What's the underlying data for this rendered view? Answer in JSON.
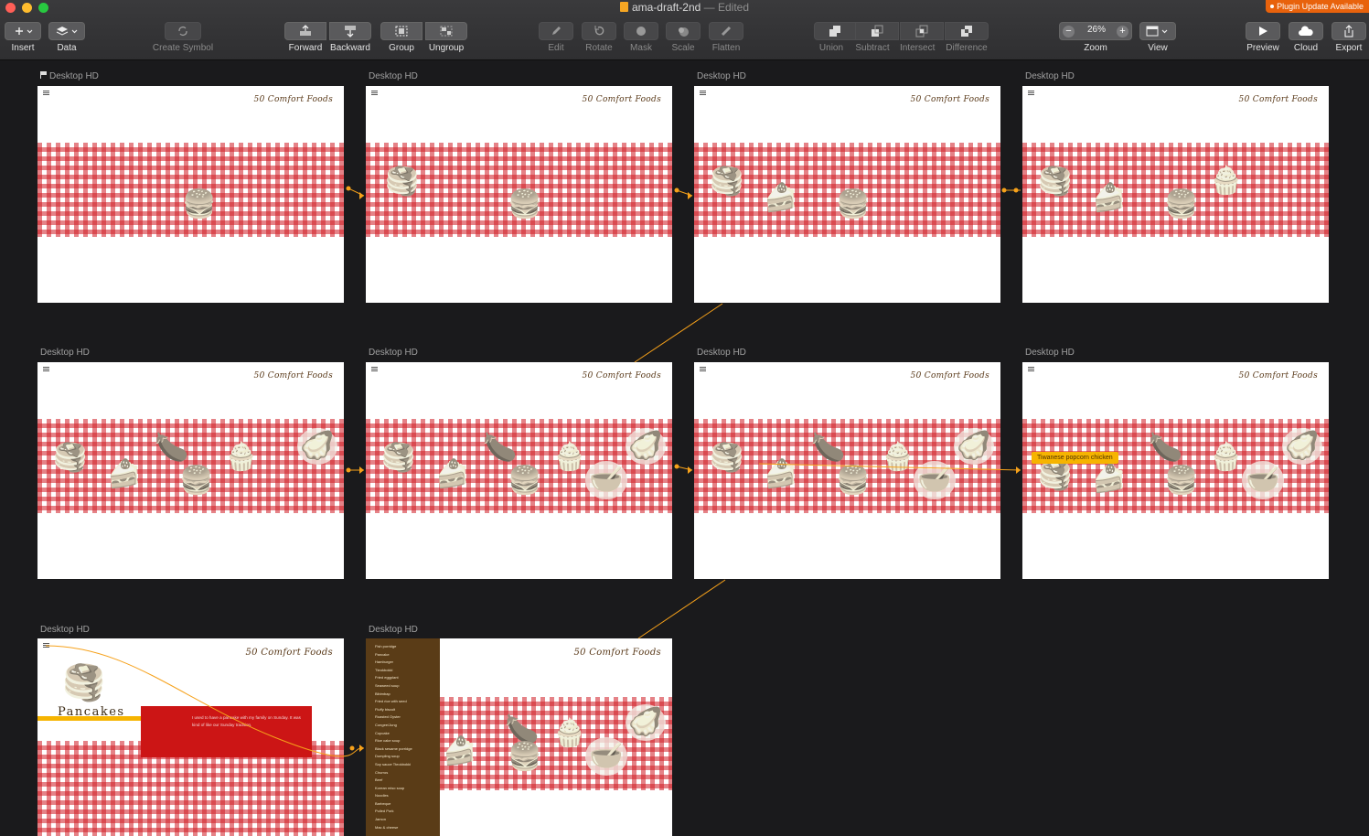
{
  "window": {
    "file_name": "ama-draft-2nd",
    "edited_suffix": "— Edited",
    "plugin_badge": "Plugin Update Available",
    "colors": {
      "close": "#ff5f57",
      "minimize": "#febc2e",
      "maximize": "#28c840",
      "badge": "#e8620c"
    }
  },
  "toolbar": {
    "insert": "Insert",
    "data": "Data",
    "create_symbol": "Create Symbol",
    "forward": "Forward",
    "backward": "Backward",
    "group": "Group",
    "ungroup": "Ungroup",
    "edit": "Edit",
    "rotate": "Rotate",
    "mask": "Mask",
    "scale": "Scale",
    "flatten": "Flatten",
    "union": "Union",
    "subtract": "Subtract",
    "intersect": "Intersect",
    "difference": "Difference",
    "zoom_value": "26%",
    "zoom": "Zoom",
    "view": "View",
    "preview": "Preview",
    "cloud": "Cloud",
    "export": "Export"
  },
  "artboards": [
    {
      "label": "Desktop HD",
      "title": "50 Comfort Foods"
    },
    {
      "label": "Desktop HD",
      "title": "50 Comfort Foods"
    },
    {
      "label": "Desktop HD",
      "title": "50 Comfort Foods"
    },
    {
      "label": "Desktop HD",
      "title": "50 Comfort Foods"
    },
    {
      "label": "Desktop HD",
      "title": "50 Comfort Foods"
    },
    {
      "label": "Desktop HD",
      "title": "50 Comfort Foods"
    },
    {
      "label": "Desktop HD",
      "title": "50 Comfort Foods"
    },
    {
      "label": "Desktop HD",
      "title": "50 Comfort Foods",
      "popup": "Tiwanese popcorn chicken"
    },
    {
      "label": "Desktop HD",
      "title": "50 Comfort Foods",
      "dish": "Pancakes",
      "description": "I used to have a pancake with my family on Sunday. It was kind of like our Sunday tradition."
    },
    {
      "label": "Desktop HD",
      "title": "50 Comfort Foods"
    }
  ],
  "food_list": [
    "Fish porridge",
    "Pancake",
    "Hamburger",
    "Tteokbokki",
    "Fried eggplant",
    "Seaweed soup",
    "Bibimbap",
    "Fried rice with seed",
    "Fluffy biscuit",
    "Roasted Oyster",
    "Congee/Jung",
    "Cupcake",
    "Rice cake soup",
    "Black sesame porridge",
    "Dumpling soup",
    "Soy sauce Tteokbokki",
    "Churros",
    "Beef",
    "Korean miso soup",
    "Noodles",
    "Barbeque",
    "Pulled Pork",
    "Jamon",
    "Mac & cheese"
  ],
  "icons": {
    "pancake": "pancake-stack-icon",
    "burger": "hamburger-icon",
    "cake": "cake-slice-icon",
    "cupcake": "cupcake-icon",
    "oyster": "oyster-icon",
    "eggplant": "eggplant-icon",
    "soup": "soup-bowl-icon"
  },
  "colors": {
    "canvas": "#1a1a1c",
    "gingham_red": "#d01c24",
    "link": "#f6a11a",
    "sidebar": "#5a3c17",
    "popup": "#f6b400"
  }
}
